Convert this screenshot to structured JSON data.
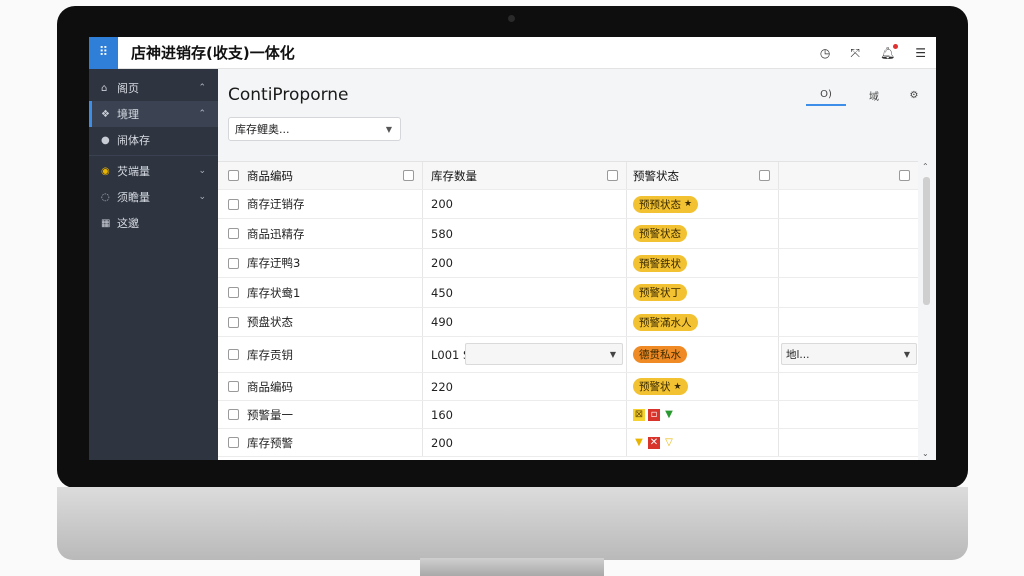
{
  "app": {
    "title": "店神进销存(收支)一体化"
  },
  "topbar_icons": [
    "clock-icon",
    "expand-icon",
    "bell-icon",
    "menu-icon"
  ],
  "sidebar": {
    "items": [
      {
        "label": "阁页",
        "icon": "home-icon",
        "chevron": "^"
      },
      {
        "label": "境理",
        "icon": "grid-icon",
        "chevron": "^",
        "active": true
      },
      {
        "label": "闹体存",
        "icon": "user-icon"
      },
      {
        "label": "芡端量",
        "icon": "chrome-icon",
        "chevron": "v"
      },
      {
        "label": "须瞻量",
        "icon": "circle-icon",
        "chevron": "v"
      },
      {
        "label": "这邈",
        "icon": "building-icon"
      }
    ]
  },
  "main": {
    "title": "ContiProporne",
    "toolbar": {
      "btn1": "O)",
      "btn2": "域"
    },
    "filter": {
      "value": "库存鲤奥..."
    }
  },
  "table": {
    "headers": [
      "商品编码",
      "库存数量",
      "预警状态",
      ""
    ],
    "rows": [
      {
        "name": "商存迂销存",
        "qty": "200",
        "status": "预预状态",
        "style": "yellow"
      },
      {
        "name": "商品迅精存",
        "qty": "580",
        "status": "预警状态",
        "style": "yellow"
      },
      {
        "name": "库存迂鸭3",
        "qty": "200",
        "status": "預警鉄状",
        "style": "yellow"
      },
      {
        "name": "库存状鸯1",
        "qty": "450",
        "status": "预警状丁",
        "style": "yellow"
      },
      {
        "name": "预盘状态",
        "qty": "490",
        "status": "预警滿水人",
        "style": "yellow"
      },
      {
        "name": "库存贡钥",
        "qty": "L001 S",
        "status": "德贯私水",
        "style": "orange",
        "extra": "地l..."
      },
      {
        "name": "商品编码",
        "qty": "220",
        "status": "预警状",
        "style": "yellow"
      },
      {
        "name": "预警量一",
        "qty": "160",
        "status": "",
        "style": "flags-a"
      },
      {
        "name": "库存预警",
        "qty": "200",
        "status": "",
        "style": "flags-b"
      }
    ]
  },
  "colors": {
    "accent": "#2f7fd9",
    "sidebar": "#2e3440",
    "badge_yellow": "#f2c232",
    "badge_orange": "#ef8a24"
  }
}
